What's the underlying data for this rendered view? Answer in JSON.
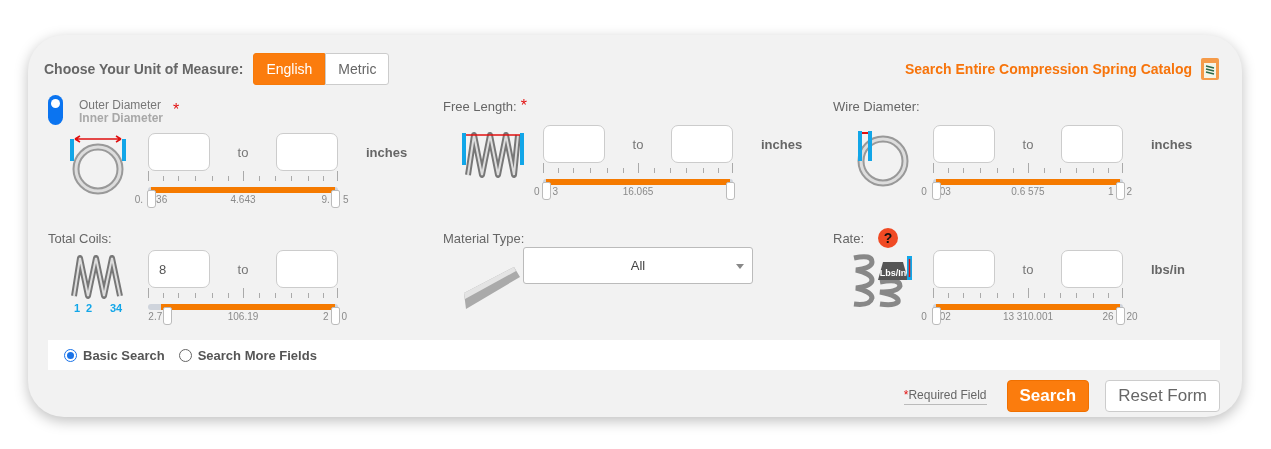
{
  "unit_selector": {
    "label": "Choose Your Unit of Measure:",
    "options": [
      {
        "label": "English",
        "selected": true
      },
      {
        "label": "Metric",
        "selected": false
      }
    ]
  },
  "catalog_link": "Search Entire Compression Spring Catalog",
  "fields": [
    {
      "kind": "ring",
      "diameter_options": [
        {
          "label": "Outer Diameter",
          "selected": true
        },
        {
          "label": "Inner Diameter",
          "selected": false
        }
      ],
      "required": true,
      "to": "to",
      "unit": "inches",
      "level": 1,
      "scale": {
        "min": [
          "0.",
          "36"
        ],
        "mid": "4.643",
        "max": [
          "9.",
          "5"
        ]
      }
    },
    {
      "kind": "spring",
      "label": "Free Length:",
      "required": true,
      "to": "to",
      "unit": "inches",
      "level": 1,
      "scale": {
        "min": [
          "0",
          "3"
        ],
        "mid": "16.065"
      }
    },
    {
      "kind": "wire",
      "label": "Wire Diameter:",
      "required": false,
      "to": "to",
      "unit": "inches",
      "level": 1,
      "scale": {
        "min": [
          "0",
          "03"
        ],
        "mid": "0.6 575",
        "max": [
          "1",
          "2"
        ]
      }
    },
    {
      "kind": "coils",
      "label": "Total Coils:",
      "required": false,
      "coil_numbers": [
        "1",
        "2",
        "34"
      ],
      "min_value": "8",
      "to": "to",
      "level": 0.93,
      "scale": {
        "min": [
          "2.7"
        ],
        "mid": "106.19",
        "max": [
          "2",
          "0"
        ]
      }
    },
    {
      "kind": "select",
      "label": "Material Type:",
      "value": "All"
    },
    {
      "kind": "rate",
      "label": "Rate:",
      "help": "?",
      "weight_label": "Lbs/In",
      "required": false,
      "to": "to",
      "unit": "lbs/in",
      "level": 1,
      "scale": {
        "min": [
          "0",
          "02"
        ],
        "mid": "13 310.001",
        "max": [
          "26",
          "20"
        ]
      }
    }
  ],
  "search_modes": [
    {
      "label": "Basic Search",
      "selected": true
    },
    {
      "label": "Search More Fields",
      "selected": false
    }
  ],
  "required_note": {
    "mark": "*",
    "text": "Required Field"
  },
  "buttons": [
    {
      "kind": "primary",
      "label": "Search"
    },
    {
      "kind": "secondary",
      "label": "Reset Form"
    }
  ]
}
